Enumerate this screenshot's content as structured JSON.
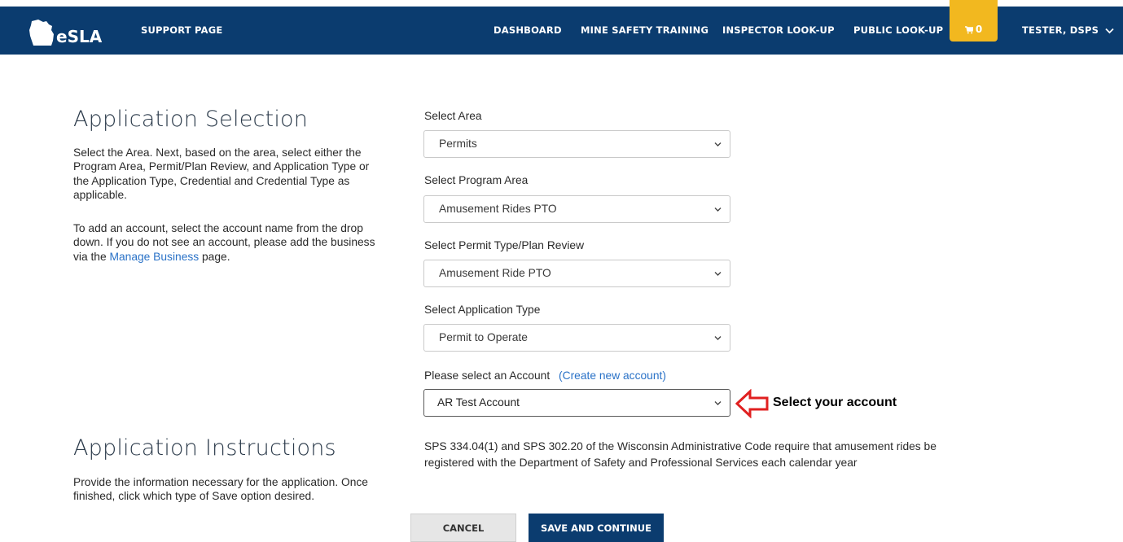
{
  "navbar": {
    "brand": "eSLA",
    "support": "SUPPORT PAGE",
    "dashboard": "DASHBOARD",
    "mine_safety": "MINE SAFETY TRAINING",
    "inspector_lookup": "INSPECTOR LOOK-UP",
    "public_lookup": "PUBLIC LOOK-UP",
    "cart_count": "0",
    "user": "TESTER, DSPS",
    "brand_color": "#0b3c6f",
    "cart_color": "#f2b81f"
  },
  "selection": {
    "title": "Application Selection",
    "para1": "Select the Area. Next, based on the area, select either the Program Area, Permit/Plan Review, and Application Type or the Application Type, Credential and Credential Type as applicable.",
    "para2_before": "To add an account, select the account name from the drop down. If you do not see an account, please add the business via the ",
    "para2_link": "Manage Business",
    "para2_after": " page."
  },
  "form": {
    "area_label": "Select Area",
    "area_value": "Permits",
    "program_label": "Select Program Area",
    "program_value": "Amusement Rides PTO",
    "permit_type_label": "Select Permit Type/Plan Review",
    "permit_type_value": "Amusement Ride PTO",
    "app_type_label": "Select Application Type",
    "app_type_value": "Permit to Operate",
    "account_label": "Please select an Account",
    "account_link": "(Create new account)",
    "account_value": "AR Test Account"
  },
  "callout": {
    "text": "Select your account",
    "color": "#e02020"
  },
  "instructions": {
    "title": "Application Instructions",
    "para": "Provide the information necessary for the application. Once finished, click which type of Save option desired.",
    "legal": "SPS 334.04(1) and SPS 302.20 of the Wisconsin Administrative Code require that amusement rides be registered with the Department of Safety and Professional Services each calendar year"
  },
  "buttons": {
    "cancel": "CANCEL",
    "save": "SAVE AND CONTINUE"
  }
}
